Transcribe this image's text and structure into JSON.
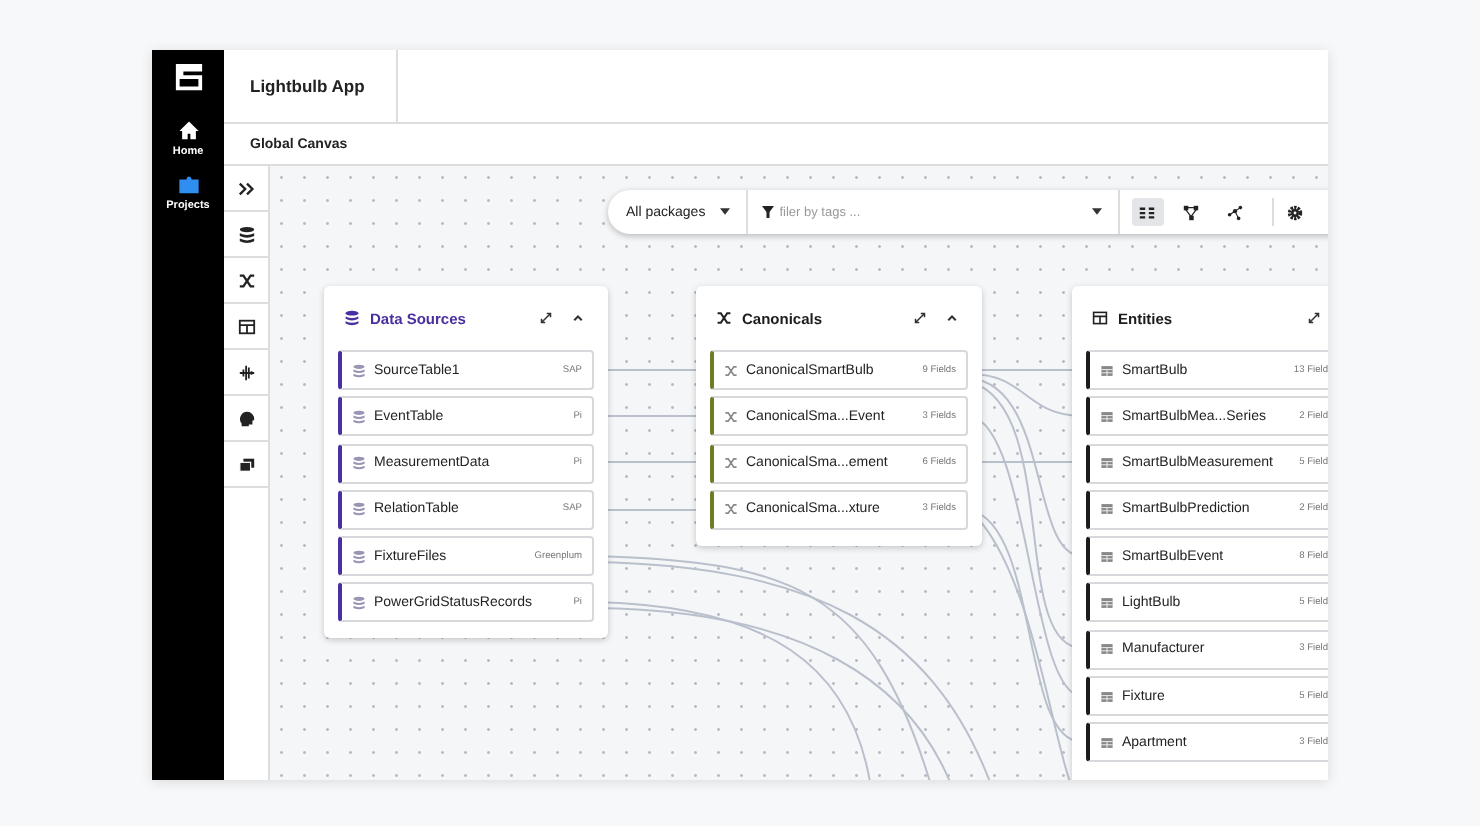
{
  "app": {
    "title": "Lightbulb App"
  },
  "nav": [
    {
      "label": "Home",
      "kind": "home",
      "selected": false
    },
    {
      "label": "Projects",
      "kind": "projects",
      "selected": true
    }
  ],
  "breadcrumb": "Global Canvas",
  "toolbar": {
    "package": "All packages",
    "filter_placeholder": "filer by tags ...",
    "views": [
      {
        "kind": "list",
        "selected": true
      },
      {
        "kind": "tree",
        "selected": false
      },
      {
        "kind": "graph",
        "selected": false
      }
    ]
  },
  "panels": [
    {
      "title": "Data Sources",
      "kind": "source",
      "items": [
        {
          "name": "SourceTable1",
          "tag": "SAP"
        },
        {
          "name": "EventTable",
          "tag": "Pi"
        },
        {
          "name": "MeasurementData",
          "tag": "Pi"
        },
        {
          "name": "RelationTable",
          "tag": "SAP"
        },
        {
          "name": "FixtureFiles",
          "tag": "Greenplum"
        },
        {
          "name": "PowerGridStatusRecords",
          "tag": "Pi"
        }
      ]
    },
    {
      "title": "Canonicals",
      "kind": "canonical",
      "items": [
        {
          "name": "CanonicalSmartBulb",
          "tag": "9 Fields"
        },
        {
          "name": "CanonicalSma...Event",
          "tag": "3 Fields"
        },
        {
          "name": "CanonicalSma...ement",
          "tag": "6 Fields"
        },
        {
          "name": "CanonicalSma...xture",
          "tag": "3 Fields"
        }
      ]
    },
    {
      "title": "Entities",
      "kind": "entity",
      "items": [
        {
          "name": "SmartBulb",
          "tag": "13 Field"
        },
        {
          "name": "SmartBulbMea...Series",
          "tag": "2 Field"
        },
        {
          "name": "SmartBulbMeasurement",
          "tag": "5 Field"
        },
        {
          "name": "SmartBulbPrediction",
          "tag": "2 Field"
        },
        {
          "name": "SmartBulbEvent",
          "tag": "8 Field"
        },
        {
          "name": "LightBulb",
          "tag": "5 Field"
        },
        {
          "name": "Manufacturer",
          "tag": "3 Field"
        },
        {
          "name": "Fixture",
          "tag": "5 Field"
        },
        {
          "name": "Apartment",
          "tag": "3 Field"
        }
      ]
    }
  ]
}
